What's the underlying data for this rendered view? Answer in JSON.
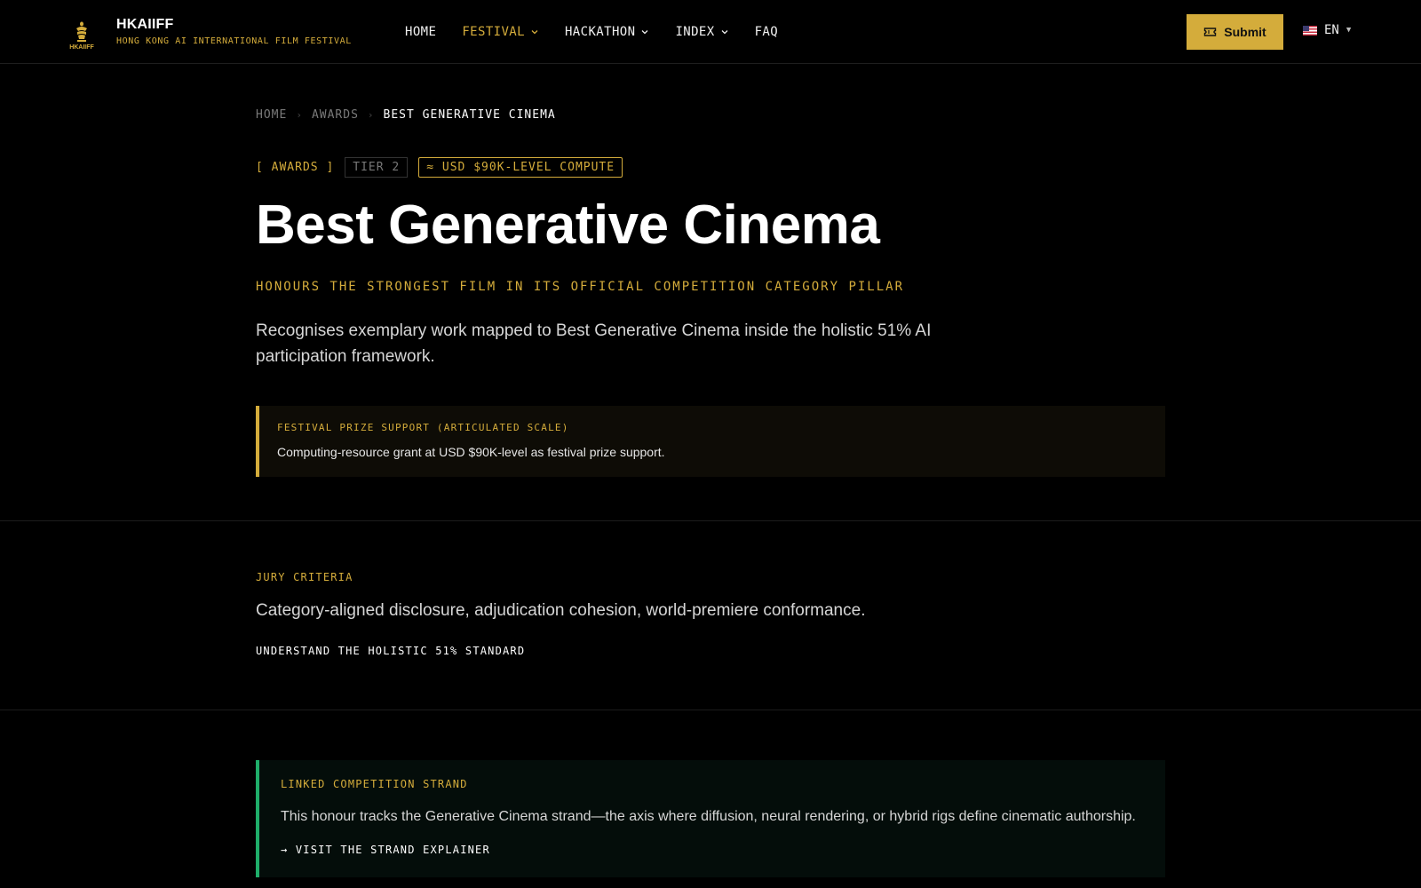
{
  "header": {
    "brand_name": "HKAIIFF",
    "brand_sub": "HONG KONG AI INTERNATIONAL FILM FESTIVAL",
    "logo_text": "HKAIIFF",
    "nav": [
      {
        "label": "HOME",
        "icon": "",
        "active": false
      },
      {
        "label": "FESTIVAL",
        "icon": "chevron-down-icon",
        "active": true
      },
      {
        "label": "HACKATHON",
        "icon": "chevron-down-icon",
        "active": false
      },
      {
        "label": "INDEX",
        "icon": "chevron-down-icon",
        "active": false
      },
      {
        "label": "FAQ",
        "icon": "",
        "active": false
      }
    ],
    "submit_label": "Submit",
    "submit_icon": "ticket-icon",
    "lang_label": "EN",
    "lang_flag": "us-flag-icon"
  },
  "breadcrumb": {
    "items": [
      "HOME",
      "AWARDS"
    ],
    "current": "BEST GENERATIVE CINEMA",
    "separator": "›"
  },
  "tags": {
    "awards": "[ AWARDS ]",
    "tier": "TIER 2",
    "compute": "≈ USD $90K-LEVEL COMPUTE"
  },
  "hero": {
    "title": "Best Generative Cinema",
    "subtitle": "HONOURS THE STRONGEST FILM IN ITS OFFICIAL COMPETITION CATEGORY PILLAR",
    "lede": "Recognises exemplary work mapped to Best Generative Cinema inside the holistic 51% AI participation framework."
  },
  "prize": {
    "label": "FESTIVAL PRIZE SUPPORT (ARTICULATED SCALE)",
    "text": "Computing-resource grant at USD $90K-level as festival prize support."
  },
  "jury": {
    "label": "JURY CRITERIA",
    "text": "Category-aligned disclosure, adjudication cohesion, world-premiere conformance.",
    "link": "UNDERSTAND THE HOLISTIC 51% STANDARD"
  },
  "strand": {
    "label": "LINKED COMPETITION STRAND",
    "text": "This honour tracks the Generative Cinema strand—the axis where diffusion, neural rendering, or hybrid rigs define cinematic authorship.",
    "link": "→ VISIT THE STRAND EXPLAINER"
  },
  "colors": {
    "accent_gold": "#d4ac3b",
    "accent_green": "#1fae6a",
    "background": "#000000"
  }
}
